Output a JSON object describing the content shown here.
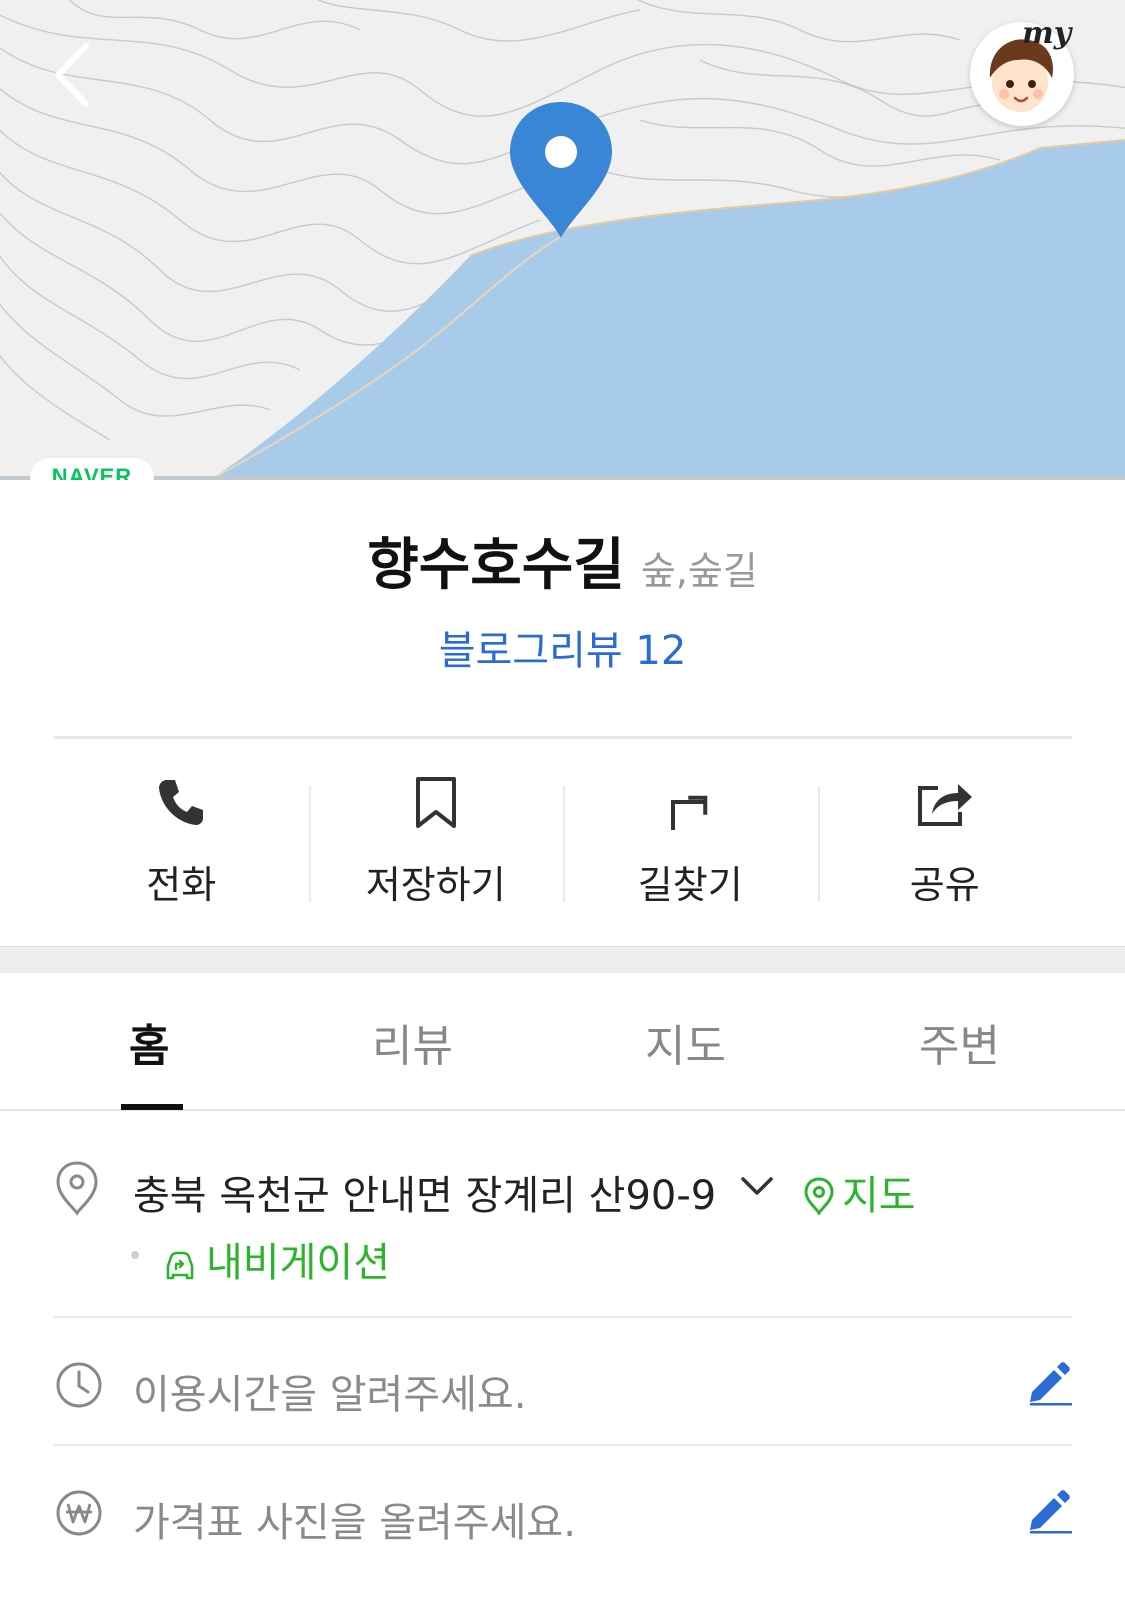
{
  "header": {
    "back_icon": "chevron-left-icon",
    "my_badge": "my",
    "map_logo": "NAVER"
  },
  "place": {
    "name": "향수호수길",
    "category": "숲,숲길",
    "blog_review": "블로그리뷰 12"
  },
  "actions": [
    {
      "label": "전화",
      "icon": "phone-icon"
    },
    {
      "label": "저장하기",
      "icon": "bookmark-icon"
    },
    {
      "label": "길찾기",
      "icon": "directions-icon"
    },
    {
      "label": "공유",
      "icon": "share-icon"
    }
  ],
  "tabs": [
    {
      "label": "홈",
      "active": true
    },
    {
      "label": "리뷰",
      "active": false
    },
    {
      "label": "지도",
      "active": false
    },
    {
      "label": "주변",
      "active": false
    }
  ],
  "info": {
    "address": "충북 옥천군 안내면 장계리 산90-9",
    "map_link": "지도",
    "navigation": "내비게이션",
    "hours_prompt": "이용시간을 알려주세요.",
    "price_prompt": "가격표 사진을 올려주세요."
  },
  "colors": {
    "accent_blue": "#2b6bd6",
    "green": "#2cb52c",
    "pin": "#3a86d6",
    "water": "#a7c9ea"
  }
}
